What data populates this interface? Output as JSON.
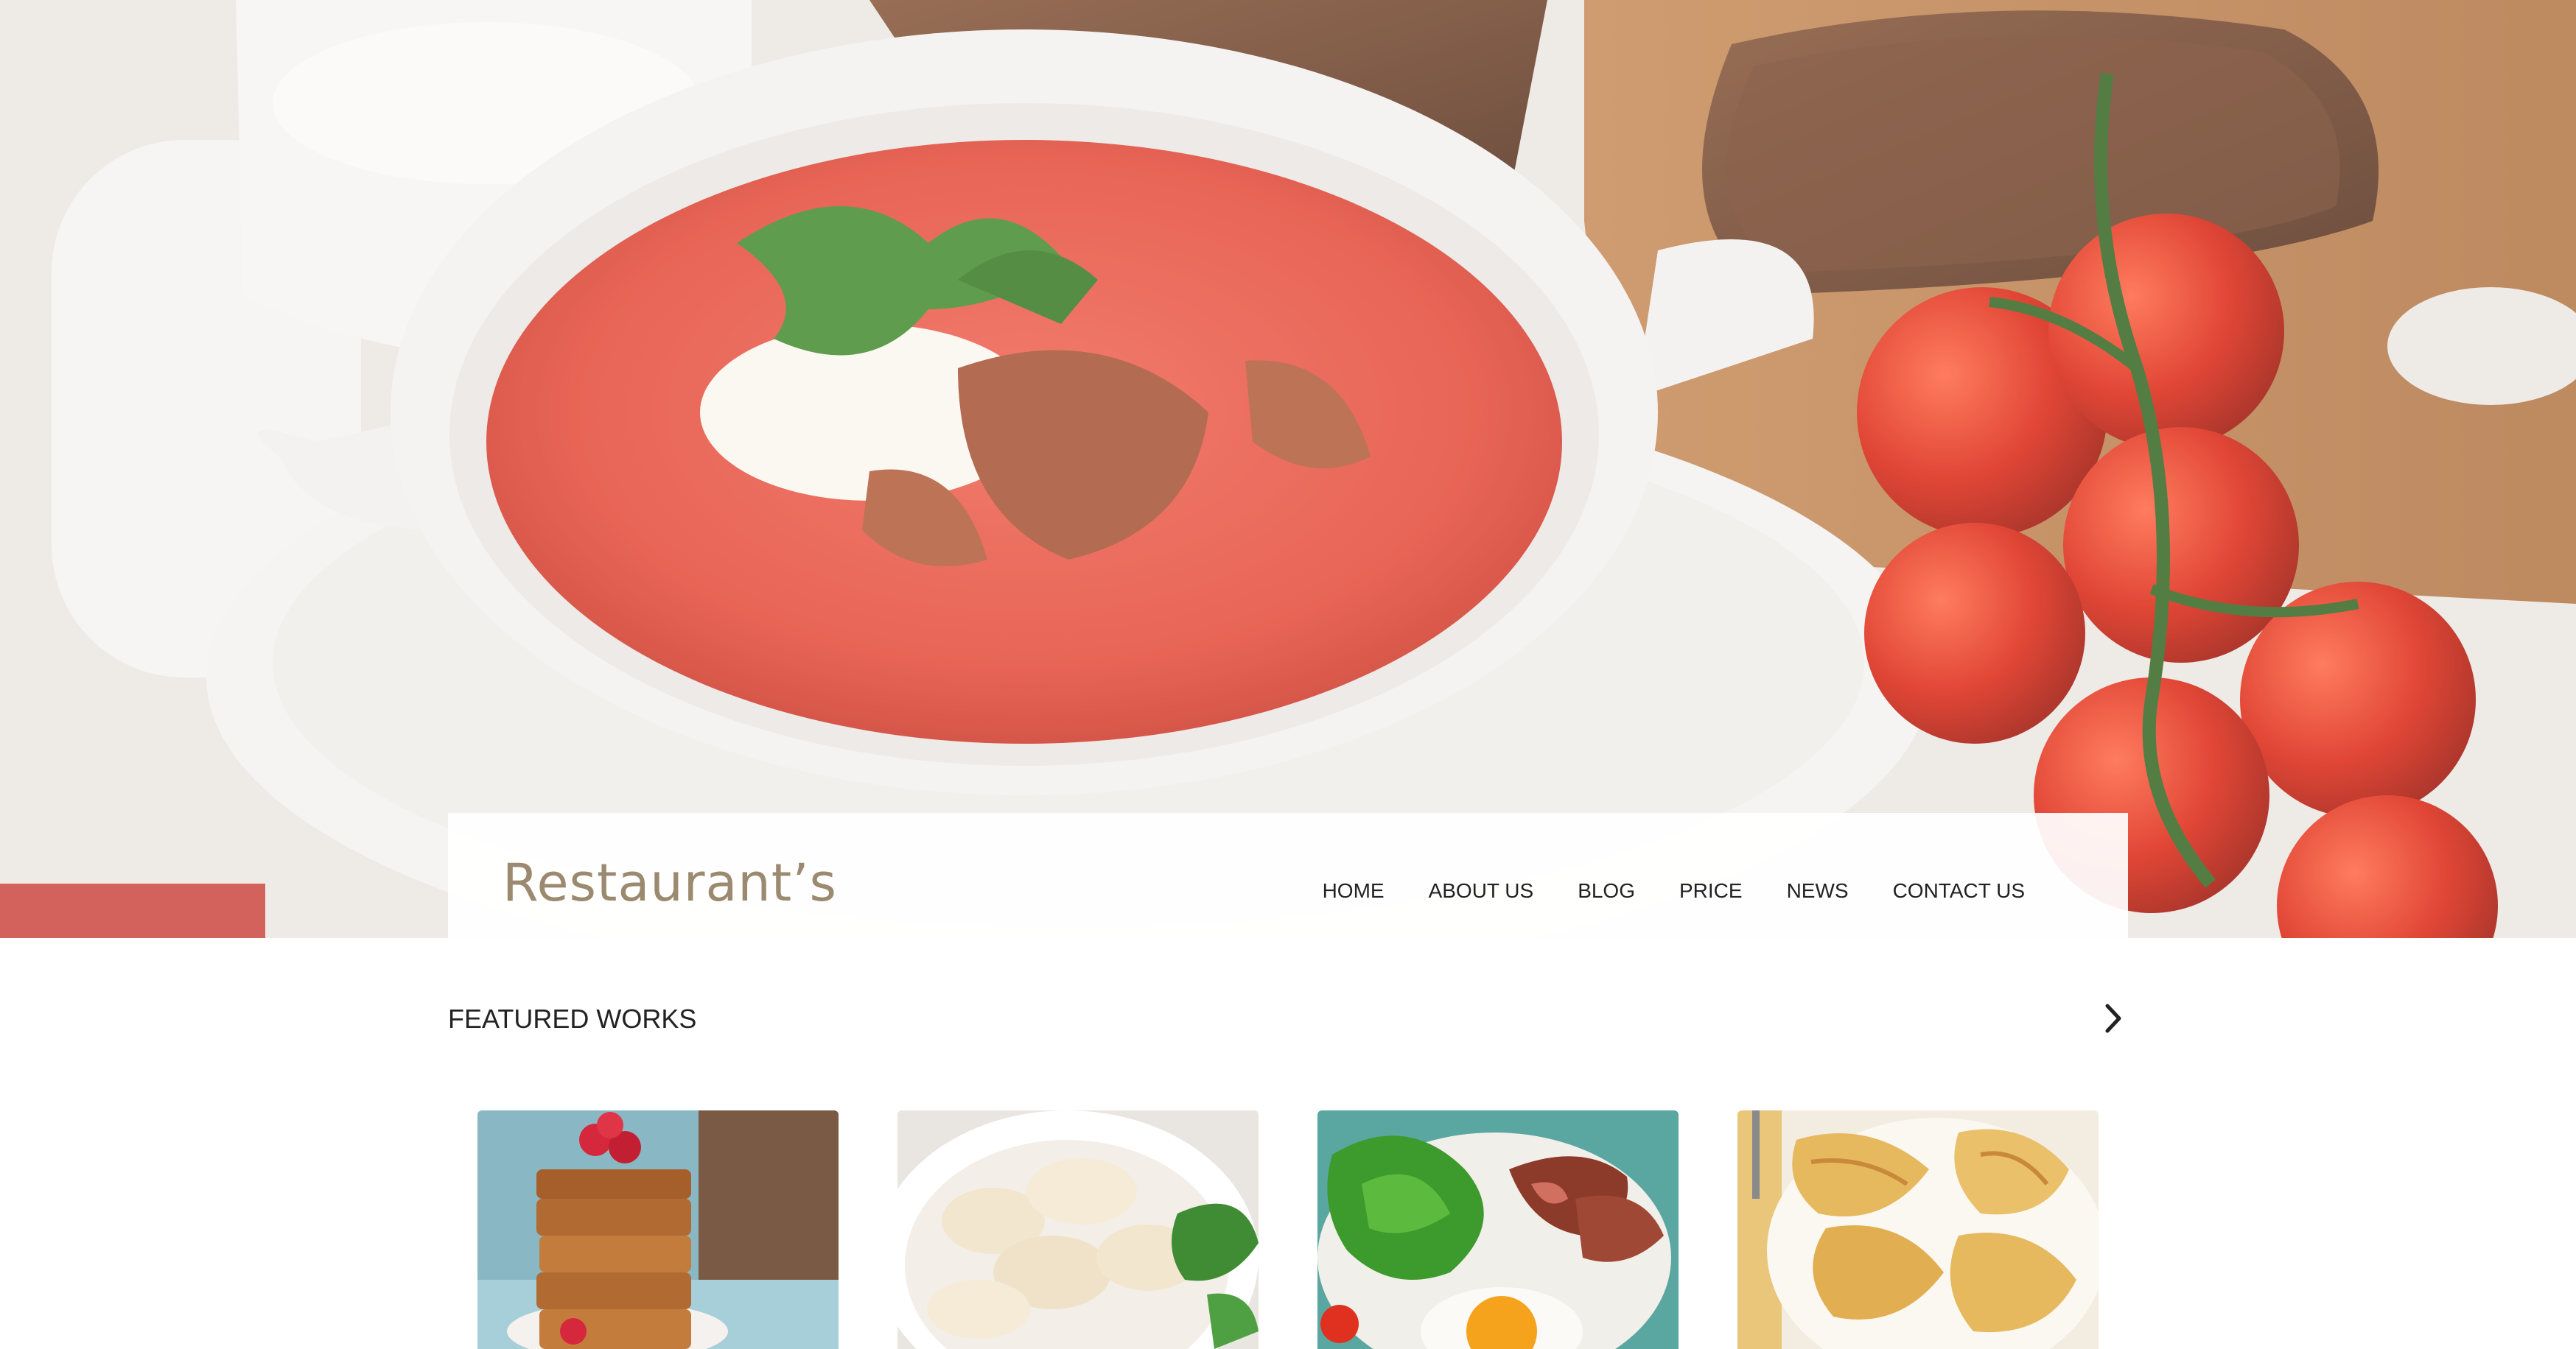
{
  "brand": {
    "logo": "Restaurant’s"
  },
  "nav": {
    "items": [
      {
        "label": "HOME"
      },
      {
        "label": "ABOUT US"
      },
      {
        "label": "BLOG"
      },
      {
        "label": "PRICE"
      },
      {
        "label": "NEWS"
      },
      {
        "label": "CONTACT US"
      }
    ]
  },
  "featured": {
    "title": "FEATURED WORKS",
    "next_icon": "chevron-right-icon",
    "cards": [
      {
        "image": "honey-cake-stack"
      },
      {
        "image": "dumplings-bowl"
      },
      {
        "image": "beef-salad-egg"
      },
      {
        "image": "pancakes-plate"
      }
    ]
  },
  "hero": {
    "image": "tomato-soup-bowl-with-bread-and-tomatoes"
  },
  "colors": {
    "logo": "#9c8a70",
    "nav_text": "#222222",
    "soup": "#e8574a",
    "bread": "#6b4431",
    "tomato": "#d9301f"
  }
}
